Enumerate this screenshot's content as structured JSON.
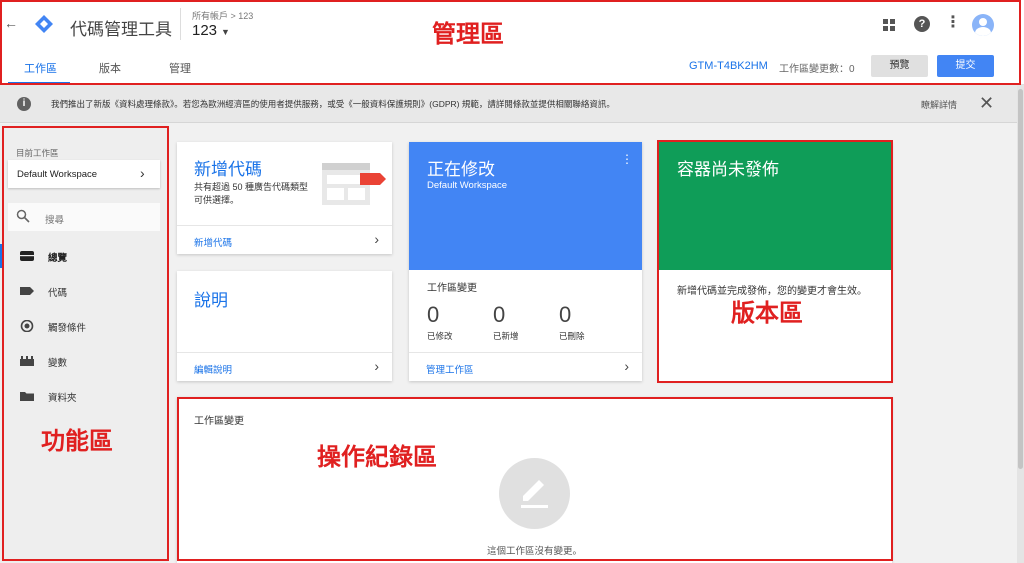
{
  "app": {
    "back_icon": "back-arrow-icon",
    "title": "代碼管理工具",
    "breadcrumb": "所有帳戶 > 123",
    "account": "123"
  },
  "tabs": [
    {
      "label": "工作區",
      "active": true
    },
    {
      "label": "版本",
      "active": false
    },
    {
      "label": "管理",
      "active": false
    }
  ],
  "toolbar": {
    "container_id": "GTM-T4BK2HM",
    "workspace_changes": "工作區變更數：0",
    "preview_label": "預覽",
    "submit_label": "提交"
  },
  "notice": {
    "text": "我們推出了新版《資料處理條款》。若您為歐洲經濟區的使用者提供服務，或受《一般資料保護規則》(GDPR) 規範，請詳閱條款並提供相關聯絡資訊。",
    "link": "瞭解詳情"
  },
  "sidebar": {
    "workspace_label": "目前工作區",
    "workspace_value": "Default Workspace",
    "search_placeholder": "搜尋",
    "items": [
      {
        "label": "總覽",
        "icon": "overview-icon",
        "active": true
      },
      {
        "label": "代碼",
        "icon": "tag-icon",
        "active": false
      },
      {
        "label": "觸發條件",
        "icon": "trigger-icon",
        "active": false
      },
      {
        "label": "變數",
        "icon": "variable-icon",
        "active": false
      },
      {
        "label": "資料夾",
        "icon": "folder-icon",
        "active": false
      }
    ]
  },
  "cards": {
    "new_tag": {
      "title": "新增代碼",
      "desc": "共有超過 50 種廣告代碼類型可供選擇。",
      "link": "新增代碼"
    },
    "help": {
      "title": "說明",
      "link": "編輯說明"
    },
    "editing": {
      "title": "正在修改",
      "subtitle": "Default Workspace",
      "changes_label": "工作區變更",
      "stats": [
        {
          "value": "0",
          "label": "已修改"
        },
        {
          "value": "0",
          "label": "已新增"
        },
        {
          "value": "0",
          "label": "已刪除"
        }
      ],
      "link": "管理工作區"
    },
    "status": {
      "title": "容器尚未發佈",
      "message": "新增代碼並完成發佈，您的變更才會生效。"
    },
    "changes": {
      "title": "工作區變更",
      "empty": "這個工作區沒有變更。"
    }
  },
  "annotations": {
    "management": "管理區",
    "function": "功能區",
    "version": "版本區",
    "log": "操作紀錄區"
  },
  "colors": {
    "accent": "#1a73e8",
    "editing_card": "#4285f4",
    "status_card": "#0f9d58",
    "annotation": "#e02020"
  }
}
